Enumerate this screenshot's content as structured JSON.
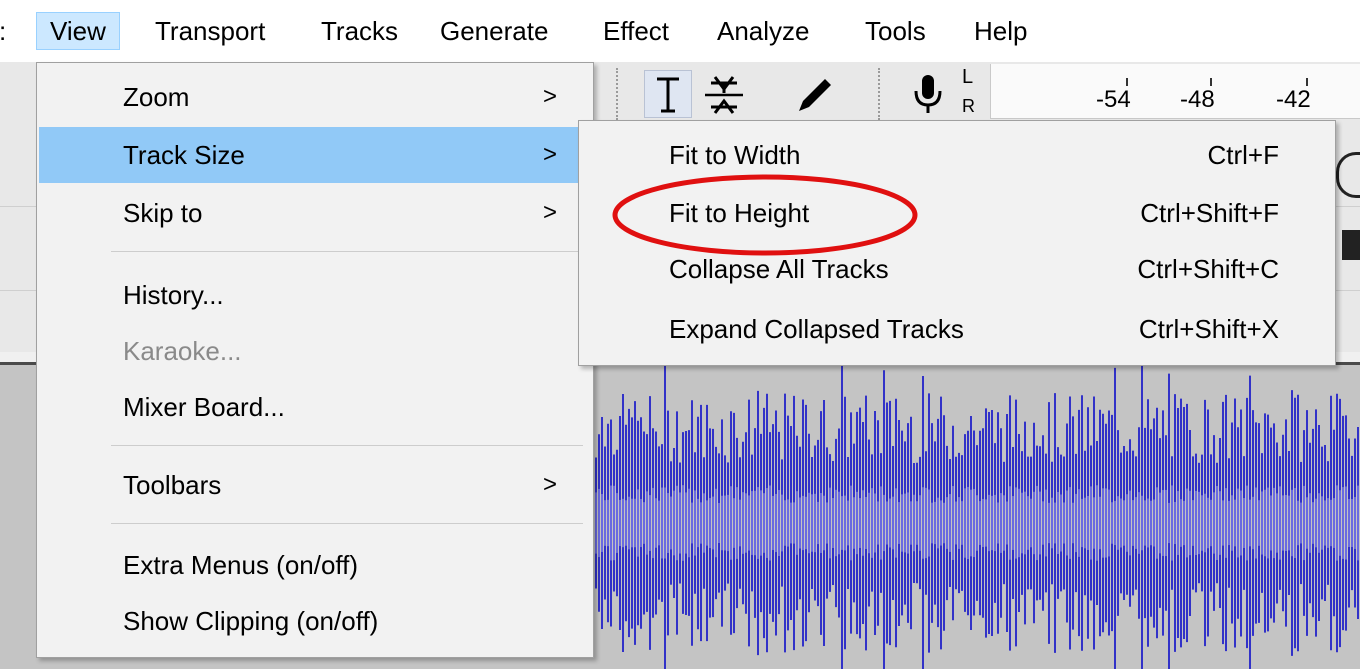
{
  "menubar": {
    "items": [
      "View",
      "Transport",
      "Tracks",
      "Generate",
      "Effect",
      "Analyze",
      "Tools",
      "Help"
    ],
    "open_index": 0
  },
  "toolbar": {
    "tool_icons": [
      "text-cursor-icon",
      "envelope-icon",
      "pencil-icon"
    ],
    "mic_icon": "microphone-icon",
    "meter_channel_top": "L",
    "meter_channel_bottom": "R",
    "meter_ticks": [
      "-54",
      "-48",
      "-42"
    ]
  },
  "view_menu": {
    "items": [
      {
        "label": "Zoom",
        "submenu": true,
        "state": "normal"
      },
      {
        "label": "Track Size",
        "submenu": true,
        "state": "highlighted"
      },
      {
        "label": "Skip to",
        "submenu": true,
        "state": "normal"
      },
      {
        "label": "History...",
        "submenu": false,
        "state": "normal"
      },
      {
        "label": "Karaoke...",
        "submenu": false,
        "state": "disabled"
      },
      {
        "label": "Mixer Board...",
        "submenu": false,
        "state": "normal"
      },
      {
        "label": "Toolbars",
        "submenu": true,
        "state": "normal"
      },
      {
        "label": "Extra Menus (on/off)",
        "submenu": false,
        "state": "normal"
      },
      {
        "label": "Show Clipping (on/off)",
        "submenu": false,
        "state": "normal"
      }
    ],
    "arrow_glyph": ">"
  },
  "track_size_menu": {
    "items": [
      {
        "label": "Fit to Width",
        "shortcut": "Ctrl+F"
      },
      {
        "label": "Fit to Height",
        "shortcut": "Ctrl+Shift+F"
      },
      {
        "label": "Collapse All Tracks",
        "shortcut": "Ctrl+Shift+C"
      },
      {
        "label": "Expand Collapsed Tracks",
        "shortcut": "Ctrl+Shift+X"
      }
    ],
    "annotated_item": "Fit to Height"
  },
  "colors": {
    "highlight": "#91c9f7",
    "menubar_open": "#cce8ff",
    "waveform": "#3232c8",
    "waveform_inner": "#6a6ae0",
    "annotation": "#e01010"
  }
}
